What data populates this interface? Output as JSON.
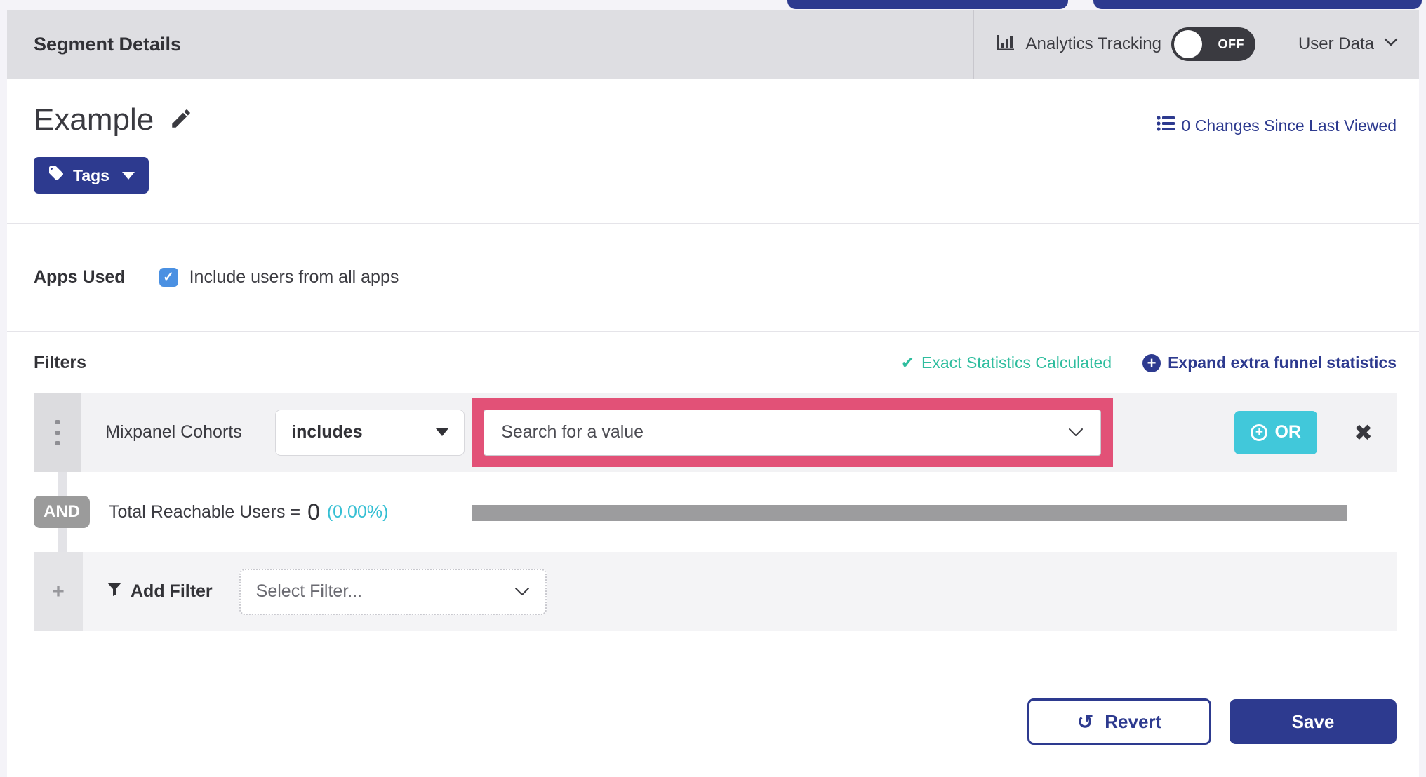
{
  "header": {
    "title": "Segment Details",
    "analytics_tracking": {
      "label": "Analytics Tracking",
      "toggle_state": "OFF"
    },
    "user_data": {
      "label": "User Data"
    }
  },
  "segment": {
    "name": "Example",
    "changes_link": "0 Changes Since Last Viewed",
    "tags_button": "Tags"
  },
  "apps_used": {
    "label": "Apps Used",
    "checkbox_label": "Include users from all apps",
    "checkbox_checked": true,
    "checkmark": "✓"
  },
  "filters": {
    "heading": "Filters",
    "exact_stats_check": "✔",
    "exact_stats": "Exact Statistics Calculated",
    "expand_plus": "+",
    "expand_link": "Expand extra funnel statistics",
    "row": {
      "name": "Mixpanel Cohorts",
      "operator": "includes",
      "value_placeholder": "Search for a value",
      "or_plus": "+",
      "or_button": "OR",
      "close": "✖"
    },
    "and_label": "AND",
    "reachable": {
      "label": "Total Reachable Users =",
      "value": "0",
      "percent": "(0.00%)"
    },
    "add": {
      "plus": "+",
      "label": "Add Filter",
      "placeholder": "Select Filter..."
    }
  },
  "footer": {
    "revert_icon": "↺",
    "revert": "Revert",
    "save": "Save"
  },
  "colors": {
    "primary_blue": "#2d3a8f",
    "header_gray": "#dedee2",
    "teal_green": "#2ebd9e",
    "cyan_accent": "#41c8da",
    "highlight_pink": "#e25177",
    "checkbox_blue": "#4a90e2",
    "and_badge_gray": "#9b9b9b",
    "bar_gray": "#9c9c9e"
  }
}
